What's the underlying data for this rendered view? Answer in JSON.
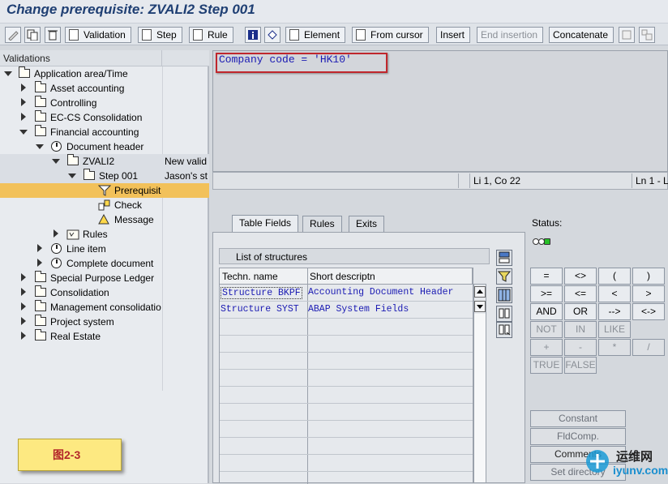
{
  "window": {
    "title": "Change prerequisite: ZVALI2 Step 001"
  },
  "toolbar": {
    "validation": "Validation",
    "step": "Step",
    "rule": "Rule",
    "element": "Element",
    "from_cursor": "From cursor",
    "insert": "Insert",
    "end_insertion": "End insertion",
    "concatenate": "Concatenate"
  },
  "tree": {
    "header": "Validations",
    "nodes": [
      {
        "label": "Application area/Time",
        "col2": ""
      },
      {
        "label": "Asset accounting",
        "col2": ""
      },
      {
        "label": "Controlling",
        "col2": ""
      },
      {
        "label": "EC-CS Consolidation",
        "col2": ""
      },
      {
        "label": "Financial accounting",
        "col2": ""
      },
      {
        "label": "Document header",
        "col2": ""
      },
      {
        "label": "ZVALI2",
        "col2": "New valid"
      },
      {
        "label": "Step 001",
        "col2": "Jason's st"
      },
      {
        "label": "Prerequisit",
        "col2": ""
      },
      {
        "label": "Check",
        "col2": ""
      },
      {
        "label": "Message",
        "col2": ""
      },
      {
        "label": "Rules",
        "col2": ""
      },
      {
        "label": "Line item",
        "col2": ""
      },
      {
        "label": "Complete document",
        "col2": ""
      },
      {
        "label": "Special Purpose Ledger",
        "col2": ""
      },
      {
        "label": "Consolidation",
        "col2": ""
      },
      {
        "label": "Management consolidatio",
        "col2": ""
      },
      {
        "label": "Project system",
        "col2": ""
      },
      {
        "label": "Real Estate",
        "col2": ""
      }
    ]
  },
  "editor": {
    "code": "Company code = 'HK10'"
  },
  "statusbar": {
    "position": "Li 1, Co 22",
    "lines": "Ln 1 - L"
  },
  "tabs": [
    {
      "label": "Table Fields"
    },
    {
      "label": "Rules"
    },
    {
      "label": "Exits"
    }
  ],
  "structures": {
    "title": "List of structures",
    "columns": [
      "Techn. name",
      "Short descriptn"
    ],
    "rows": [
      {
        "name": "Structure BKPF",
        "desc": "Accounting Document Header"
      },
      {
        "name": "Structure SYST",
        "desc": "ABAP System Fields"
      }
    ]
  },
  "status": {
    "label": "Status:"
  },
  "operators": {
    "eq": "=",
    "ne": "<>",
    "lparen": "(",
    "rparen": ")",
    "ge": ">=",
    "le": "<=",
    "lt": "<",
    "gt": ">",
    "and": "AND",
    "or": "OR",
    "arrow": "-->",
    "biarrow": "<->",
    "not": "NOT",
    "in": "IN",
    "like": "LIKE",
    "plus": "+",
    "minus": "-",
    "mult": "*",
    "div": "/",
    "true": "TRUE",
    "false": "FALSE"
  },
  "actions": {
    "constant": "Constant",
    "fldcomp": "FldComp.",
    "comments": "Comments",
    "set_directory": "Set directory"
  },
  "figure_label": "图2-3",
  "watermark": {
    "name": "运维网",
    "url": "iyunv.com"
  }
}
